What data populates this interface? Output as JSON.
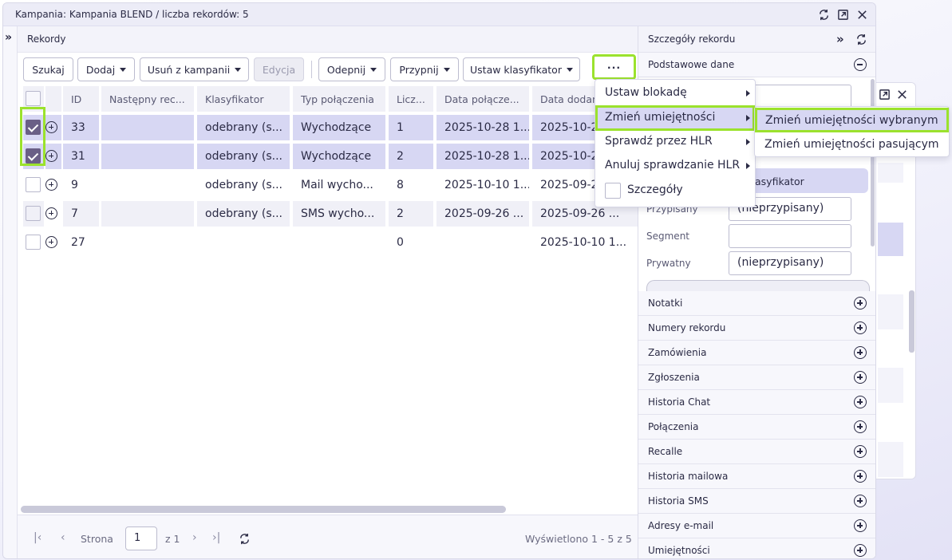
{
  "window": {
    "title": "Kampania: Kampania BLEND / liczba rekordów: 5"
  },
  "records": {
    "header": "Rekordy",
    "toolbar": {
      "search": "Szukaj",
      "add": "Dodaj",
      "remove": "Usuń z kampanii",
      "edit": "Edycja",
      "unpin": "Odepnij",
      "pin": "Przypnij",
      "classifier": "Ustaw klasyfikator",
      "more": "···"
    },
    "columns": [
      "ID",
      "Następny rec...",
      "Klasyfikator",
      "Typ połączenia",
      "Licz...",
      "Data połącze...",
      "Data dodan"
    ],
    "rows": [
      {
        "checked": true,
        "id": "33",
        "next": "",
        "classifier": "odebrany (s...",
        "type": "Wychodzące",
        "count": "1",
        "conn_date": "2025-10-28 1...",
        "added": "2025-10-28"
      },
      {
        "checked": true,
        "id": "31",
        "next": "",
        "classifier": "odebrany (s...",
        "type": "Wychodzące",
        "count": "2",
        "conn_date": "2025-10-28 1...",
        "added": "2025-10-28"
      },
      {
        "checked": false,
        "id": "9",
        "next": "",
        "classifier": "odebrany (s...",
        "type": "Mail wycho...",
        "count": "8",
        "conn_date": "2025-10-10 1...",
        "added": "2025-09-2"
      },
      {
        "checked": false,
        "id": "7",
        "next": "",
        "classifier": "odebrany (s...",
        "type": "SMS wycho...",
        "count": "2",
        "conn_date": "2025-09-26 ...",
        "added": "2025-09-26 ..."
      },
      {
        "checked": false,
        "id": "27",
        "next": "",
        "classifier": "",
        "type": "",
        "count": "0",
        "conn_date": "",
        "added": "2025-10-10 1..."
      }
    ],
    "pager": {
      "page_label": "Strona",
      "page": "1",
      "of": "z 1",
      "summary": "Wyświetlono 1 - 5 z 5"
    }
  },
  "details": {
    "header": "Szczegóły rekordu",
    "basic": "Podstawowe dane",
    "klasyfikator_fragment": "asyfikator",
    "fields": [
      {
        "label": "Przypisany",
        "value": "(nieprzypisany)"
      },
      {
        "label": "Segment",
        "value": ""
      },
      {
        "label": "Prywatny",
        "value": "(nieprzypisany)"
      }
    ],
    "sections": [
      "Notatki",
      "Numery rekordu",
      "Zamówienia",
      "Zgłoszenia",
      "Historia Chat",
      "Połączenia",
      "Recalle",
      "Historia mailowa",
      "Historia SMS",
      "Adresy e-mail",
      "Umiejętności"
    ]
  },
  "menu": {
    "items": [
      "Ustaw blokadę",
      "Zmień umiejętności",
      "Sprawdź przez HLR",
      "Anuluj sprawdzanie HLR",
      "Szczegóły"
    ],
    "submenu": [
      "Zmień umiejętności wybranym",
      "Zmień umiejętności pasującym"
    ]
  },
  "colors": {
    "accent": "#9be22d",
    "selection": "#d7d7f3",
    "checkbox": "#6a5f86"
  }
}
